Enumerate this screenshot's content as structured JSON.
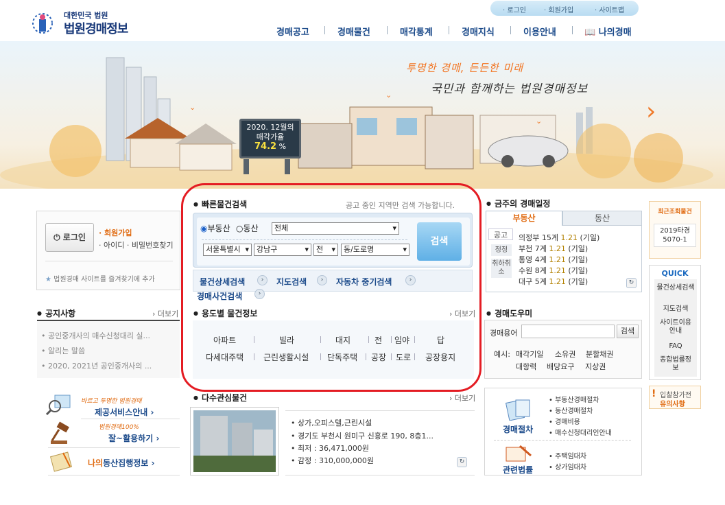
{
  "header": {
    "logo_small": "대한민국 법원",
    "logo_big": "법원경매정보",
    "top_links": [
      "로그인",
      "회원가입",
      "사이트맵"
    ],
    "nav": [
      "경매공고",
      "경매물건",
      "매각통계",
      "경매지식",
      "이용안내",
      "나의경매"
    ]
  },
  "banner": {
    "slogan1": "투명한 경매, 든든한 미래",
    "slogan2": "국민과 함께하는 법원경매정보",
    "sign_line1": "2020. 12월의",
    "sign_line2": "매각가율",
    "sign_rate": "74.2",
    "sign_unit": "%"
  },
  "login": {
    "button": "로그인",
    "join": "회원가입",
    "find": "아이디 · 비밀번호찾기",
    "favorite": "법원경매 사이트를 즐겨찾기에 추가"
  },
  "notice": {
    "title": "공지사항",
    "more": "더보기",
    "items": [
      "공인중개사의 매수신청대리 실...",
      "알리는 말씀",
      "2020, 2021년 공인중개사의 ..."
    ]
  },
  "promo": [
    {
      "small": "바르고 투명한 법원경매",
      "label": "제공서비스안내"
    },
    {
      "small": "법원경매100%",
      "label": "잘~활용하기"
    },
    {
      "small": "",
      "label_a": "나의",
      "label_b": "동산집행정보"
    }
  ],
  "quick_search": {
    "title": "빠른물건검색",
    "note": "공고 중인 지역만 검색 가능합니다.",
    "radio": [
      "부동산",
      "동산"
    ],
    "type_select": "전체",
    "selects": [
      "서울특별시",
      "강남구",
      "전",
      "동/도로명"
    ],
    "search_button": "검색",
    "links": [
      "물건상세검색",
      "지도검색",
      "자동차 중기검색",
      "경매사건검색"
    ]
  },
  "usage": {
    "title": "용도별 물건정보",
    "more": "더보기",
    "row1": [
      "아파트",
      "빌라",
      "대지",
      "전",
      "임야",
      "답"
    ],
    "row2": [
      "다세대주택",
      "근린생활시설",
      "단독주택",
      "공장",
      "도로",
      "공장용지"
    ]
  },
  "interest": {
    "title": "다수관심물건",
    "more": "더보기",
    "items": [
      "상가,오피스텔,근린시설",
      "경기도 부천시 원미구 신흥로 190, 8층1...",
      "최저 : 36,471,000원",
      "감정 : 310,000,000원"
    ]
  },
  "schedule": {
    "title": "금주의 경매일정",
    "tabs": [
      "부동산",
      "동산"
    ],
    "side": [
      "공고",
      "정정",
      "취하취소"
    ],
    "rows": [
      {
        "court": "의정부",
        "count": "15계",
        "date": "1.21",
        "tag": "(기일)"
      },
      {
        "court": "부천",
        "count": "7계",
        "date": "1.21",
        "tag": "(기일)"
      },
      {
        "court": "통영",
        "count": "4계",
        "date": "1.21",
        "tag": "(기일)"
      },
      {
        "court": "수원",
        "count": "8계",
        "date": "1.21",
        "tag": "(기일)"
      },
      {
        "court": "대구",
        "count": "5계",
        "date": "1.21",
        "tag": "(기일)"
      }
    ]
  },
  "dict": {
    "title": "경매도우미",
    "label": "경매용어",
    "button": "검색",
    "example": "예시:",
    "terms": [
      "매각기일",
      "소유권",
      "분할채권",
      "대항력",
      "배당요구",
      "지상권"
    ]
  },
  "procedure": {
    "title": "경매절차",
    "items": [
      "부동산경매절차",
      "동산경매절차",
      "경매비용",
      "매수신청대리인안내"
    ],
    "law_title": "관련법률",
    "law_items": [
      "주택임대차",
      "상가임대차"
    ]
  },
  "recent": {
    "title": "최근조회물건",
    "item": "2019타경\n5070-1"
  },
  "quick_menu": {
    "title": "QUICK",
    "items": [
      "물건상세검색",
      "지도검색",
      "사이트이용안내",
      "FAQ",
      "종합법률정보"
    ]
  },
  "caution": {
    "line1": "입찰참가전",
    "line2": "유의사항"
  }
}
